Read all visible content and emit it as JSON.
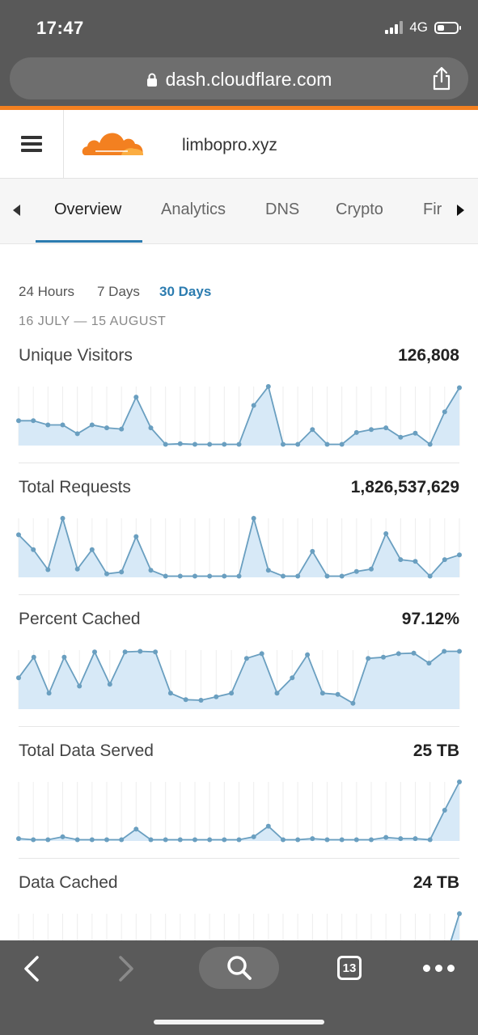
{
  "status": {
    "time": "17:47",
    "network": "4G"
  },
  "browser": {
    "url": "dash.cloudflare.com",
    "tab_count": "13"
  },
  "site": {
    "domain": "limbopro.xyz"
  },
  "tabs": [
    {
      "label": "Overview"
    },
    {
      "label": "Analytics"
    },
    {
      "label": "DNS"
    },
    {
      "label": "Crypto"
    },
    {
      "label": "Fir"
    }
  ],
  "active_tab": "Overview",
  "range_options": [
    {
      "label": "24 Hours"
    },
    {
      "label": "7 Days"
    },
    {
      "label": "30 Days"
    }
  ],
  "selected_range": "30 Days",
  "date_range": "16 JULY — 15 AUGUST",
  "colors": {
    "accent": "#2c7cb0",
    "brand": "#f38020",
    "spark_line": "#6a9fc0",
    "spark_fill": "#d7e9f7"
  },
  "chart_data": [
    {
      "type": "area",
      "title": "Unique Visitors",
      "value": "126,808",
      "values": [
        0.42,
        0.42,
        0.35,
        0.35,
        0.2,
        0.35,
        0.3,
        0.28,
        0.82,
        0.3,
        0.02,
        0.03,
        0.02,
        0.02,
        0.02,
        0.02,
        0.68,
        1.0,
        0.02,
        0.02,
        0.27,
        0.02,
        0.02,
        0.22,
        0.27,
        0.3,
        0.14,
        0.21,
        0.02,
        0.57,
        0.98
      ]
    },
    {
      "type": "area",
      "title": "Total Requests",
      "value": "1,826,537,629",
      "values": [
        0.72,
        0.47,
        0.13,
        1.0,
        0.14,
        0.47,
        0.06,
        0.09,
        0.69,
        0.12,
        0.02,
        0.02,
        0.02,
        0.02,
        0.02,
        0.02,
        1.0,
        0.12,
        0.02,
        0.02,
        0.44,
        0.02,
        0.02,
        0.1,
        0.14,
        0.74,
        0.3,
        0.27,
        0.02,
        0.3,
        0.38
      ]
    },
    {
      "type": "area",
      "title": "Percent Cached",
      "value": "97.12%",
      "values": [
        0.53,
        0.88,
        0.27,
        0.88,
        0.39,
        0.97,
        0.42,
        0.97,
        0.98,
        0.97,
        0.27,
        0.16,
        0.15,
        0.21,
        0.27,
        0.86,
        0.94,
        0.27,
        0.53,
        0.92,
        0.27,
        0.25,
        0.1,
        0.86,
        0.88,
        0.94,
        0.95,
        0.78,
        0.98,
        0.98
      ]
    },
    {
      "type": "area",
      "title": "Total Data Served",
      "value": "25 TB",
      "values": [
        0.04,
        0.02,
        0.02,
        0.07,
        0.02,
        0.02,
        0.02,
        0.02,
        0.2,
        0.02,
        0.02,
        0.02,
        0.02,
        0.02,
        0.02,
        0.02,
        0.07,
        0.25,
        0.02,
        0.02,
        0.04,
        0.02,
        0.02,
        0.02,
        0.02,
        0.06,
        0.04,
        0.04,
        0.02,
        0.52,
        1.0
      ]
    },
    {
      "type": "area",
      "title": "Data Cached",
      "value": "24 TB",
      "values": [
        0.02,
        0.02,
        0.02,
        0.02,
        0.02,
        0.02,
        0.02,
        0.02,
        0.02,
        0.02,
        0.02,
        0.02,
        0.02,
        0.02,
        0.02,
        0.02,
        0.02,
        0.02,
        0.02,
        0.02,
        0.02,
        0.02,
        0.02,
        0.02,
        0.02,
        0.02,
        0.02,
        0.02,
        0.02,
        0.2,
        1.0
      ]
    }
  ]
}
